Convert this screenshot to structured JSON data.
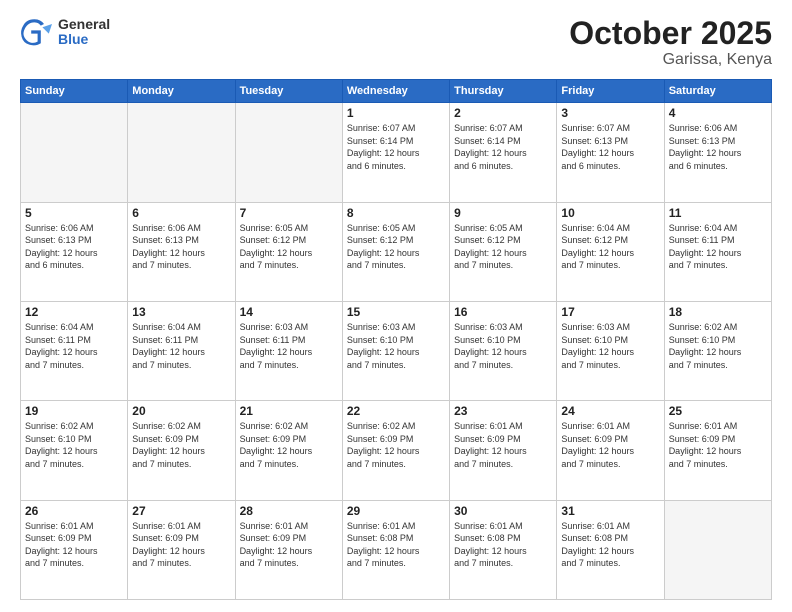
{
  "header": {
    "logo_general": "General",
    "logo_blue": "Blue",
    "month_title": "October 2025",
    "subtitle": "Garissa, Kenya"
  },
  "calendar": {
    "days_of_week": [
      "Sunday",
      "Monday",
      "Tuesday",
      "Wednesday",
      "Thursday",
      "Friday",
      "Saturday"
    ],
    "weeks": [
      [
        {
          "day": "",
          "info": "",
          "empty": true
        },
        {
          "day": "",
          "info": "",
          "empty": true
        },
        {
          "day": "",
          "info": "",
          "empty": true
        },
        {
          "day": "1",
          "info": "Sunrise: 6:07 AM\nSunset: 6:14 PM\nDaylight: 12 hours\nand 6 minutes.",
          "empty": false
        },
        {
          "day": "2",
          "info": "Sunrise: 6:07 AM\nSunset: 6:14 PM\nDaylight: 12 hours\nand 6 minutes.",
          "empty": false
        },
        {
          "day": "3",
          "info": "Sunrise: 6:07 AM\nSunset: 6:13 PM\nDaylight: 12 hours\nand 6 minutes.",
          "empty": false
        },
        {
          "day": "4",
          "info": "Sunrise: 6:06 AM\nSunset: 6:13 PM\nDaylight: 12 hours\nand 6 minutes.",
          "empty": false
        }
      ],
      [
        {
          "day": "5",
          "info": "Sunrise: 6:06 AM\nSunset: 6:13 PM\nDaylight: 12 hours\nand 6 minutes.",
          "empty": false
        },
        {
          "day": "6",
          "info": "Sunrise: 6:06 AM\nSunset: 6:13 PM\nDaylight: 12 hours\nand 7 minutes.",
          "empty": false
        },
        {
          "day": "7",
          "info": "Sunrise: 6:05 AM\nSunset: 6:12 PM\nDaylight: 12 hours\nand 7 minutes.",
          "empty": false
        },
        {
          "day": "8",
          "info": "Sunrise: 6:05 AM\nSunset: 6:12 PM\nDaylight: 12 hours\nand 7 minutes.",
          "empty": false
        },
        {
          "day": "9",
          "info": "Sunrise: 6:05 AM\nSunset: 6:12 PM\nDaylight: 12 hours\nand 7 minutes.",
          "empty": false
        },
        {
          "day": "10",
          "info": "Sunrise: 6:04 AM\nSunset: 6:12 PM\nDaylight: 12 hours\nand 7 minutes.",
          "empty": false
        },
        {
          "day": "11",
          "info": "Sunrise: 6:04 AM\nSunset: 6:11 PM\nDaylight: 12 hours\nand 7 minutes.",
          "empty": false
        }
      ],
      [
        {
          "day": "12",
          "info": "Sunrise: 6:04 AM\nSunset: 6:11 PM\nDaylight: 12 hours\nand 7 minutes.",
          "empty": false
        },
        {
          "day": "13",
          "info": "Sunrise: 6:04 AM\nSunset: 6:11 PM\nDaylight: 12 hours\nand 7 minutes.",
          "empty": false
        },
        {
          "day": "14",
          "info": "Sunrise: 6:03 AM\nSunset: 6:11 PM\nDaylight: 12 hours\nand 7 minutes.",
          "empty": false
        },
        {
          "day": "15",
          "info": "Sunrise: 6:03 AM\nSunset: 6:10 PM\nDaylight: 12 hours\nand 7 minutes.",
          "empty": false
        },
        {
          "day": "16",
          "info": "Sunrise: 6:03 AM\nSunset: 6:10 PM\nDaylight: 12 hours\nand 7 minutes.",
          "empty": false
        },
        {
          "day": "17",
          "info": "Sunrise: 6:03 AM\nSunset: 6:10 PM\nDaylight: 12 hours\nand 7 minutes.",
          "empty": false
        },
        {
          "day": "18",
          "info": "Sunrise: 6:02 AM\nSunset: 6:10 PM\nDaylight: 12 hours\nand 7 minutes.",
          "empty": false
        }
      ],
      [
        {
          "day": "19",
          "info": "Sunrise: 6:02 AM\nSunset: 6:10 PM\nDaylight: 12 hours\nand 7 minutes.",
          "empty": false
        },
        {
          "day": "20",
          "info": "Sunrise: 6:02 AM\nSunset: 6:09 PM\nDaylight: 12 hours\nand 7 minutes.",
          "empty": false
        },
        {
          "day": "21",
          "info": "Sunrise: 6:02 AM\nSunset: 6:09 PM\nDaylight: 12 hours\nand 7 minutes.",
          "empty": false
        },
        {
          "day": "22",
          "info": "Sunrise: 6:02 AM\nSunset: 6:09 PM\nDaylight: 12 hours\nand 7 minutes.",
          "empty": false
        },
        {
          "day": "23",
          "info": "Sunrise: 6:01 AM\nSunset: 6:09 PM\nDaylight: 12 hours\nand 7 minutes.",
          "empty": false
        },
        {
          "day": "24",
          "info": "Sunrise: 6:01 AM\nSunset: 6:09 PM\nDaylight: 12 hours\nand 7 minutes.",
          "empty": false
        },
        {
          "day": "25",
          "info": "Sunrise: 6:01 AM\nSunset: 6:09 PM\nDaylight: 12 hours\nand 7 minutes.",
          "empty": false
        }
      ],
      [
        {
          "day": "26",
          "info": "Sunrise: 6:01 AM\nSunset: 6:09 PM\nDaylight: 12 hours\nand 7 minutes.",
          "empty": false
        },
        {
          "day": "27",
          "info": "Sunrise: 6:01 AM\nSunset: 6:09 PM\nDaylight: 12 hours\nand 7 minutes.",
          "empty": false
        },
        {
          "day": "28",
          "info": "Sunrise: 6:01 AM\nSunset: 6:09 PM\nDaylight: 12 hours\nand 7 minutes.",
          "empty": false
        },
        {
          "day": "29",
          "info": "Sunrise: 6:01 AM\nSunset: 6:08 PM\nDaylight: 12 hours\nand 7 minutes.",
          "empty": false
        },
        {
          "day": "30",
          "info": "Sunrise: 6:01 AM\nSunset: 6:08 PM\nDaylight: 12 hours\nand 7 minutes.",
          "empty": false
        },
        {
          "day": "31",
          "info": "Sunrise: 6:01 AM\nSunset: 6:08 PM\nDaylight: 12 hours\nand 7 minutes.",
          "empty": false
        },
        {
          "day": "",
          "info": "",
          "empty": true
        }
      ]
    ]
  }
}
